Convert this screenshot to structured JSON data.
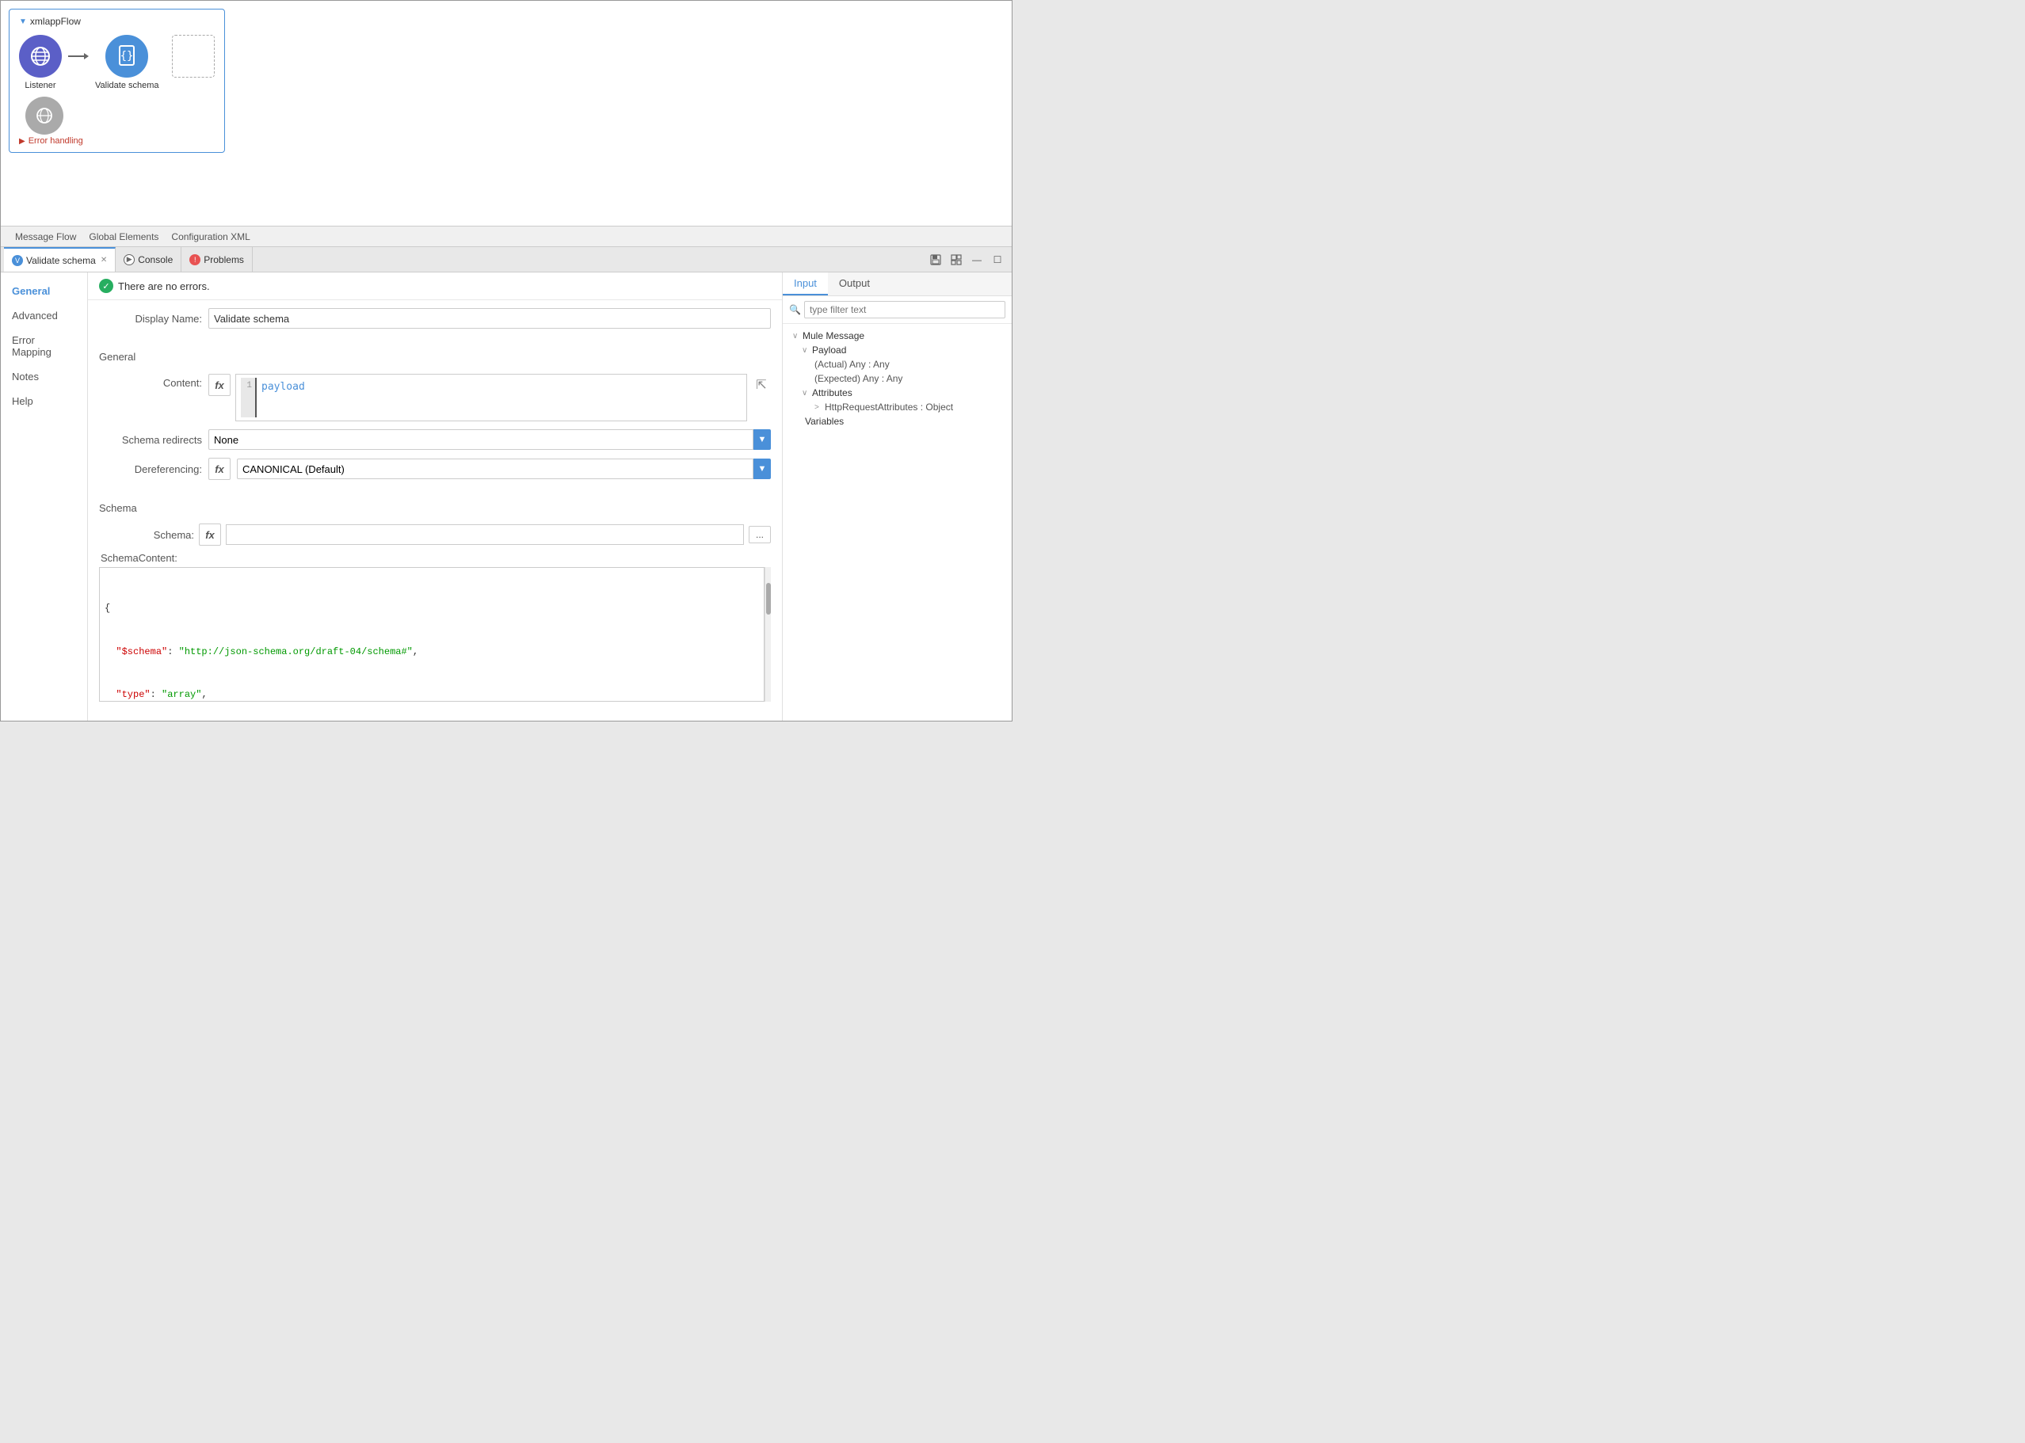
{
  "app": {
    "title": "xmlappFlow"
  },
  "canvas": {
    "flow_name": "xmlappFlow",
    "nodes": [
      {
        "id": "listener",
        "label": "Listener",
        "type": "globe",
        "style": "blue"
      },
      {
        "id": "validate_schema",
        "label": "Validate schema",
        "type": "document",
        "style": "blue-selected"
      }
    ],
    "bottom_node": {
      "label": "",
      "type": "globe",
      "style": "gray"
    },
    "error_section_label": "Error handling"
  },
  "bottom_tabs": [
    {
      "id": "message-flow",
      "label": "Message Flow"
    },
    {
      "id": "global-elements",
      "label": "Global Elements"
    },
    {
      "id": "configuration-xml",
      "label": "Configuration XML"
    }
  ],
  "panel_tabs": [
    {
      "id": "validate-schema",
      "label": "Validate schema",
      "active": true,
      "closeable": true
    },
    {
      "id": "console",
      "label": "Console",
      "active": false
    },
    {
      "id": "problems",
      "label": "Problems",
      "active": false
    }
  ],
  "panel_icons": [
    "save",
    "palette",
    "minimize",
    "maximize"
  ],
  "status": {
    "message": "There are no errors."
  },
  "form": {
    "display_name_label": "Display Name:",
    "display_name_value": "Validate schema",
    "general_section_label": "General",
    "content_label": "Content:",
    "content_code": "payload",
    "content_line_number": "1",
    "schema_redirects_label": "Schema redirects",
    "schema_redirects_value": "None",
    "dereferencing_label": "Dereferencing:",
    "dereferencing_value": "CANONICAL (Default)",
    "schema_section_label": "Schema",
    "schema_label": "Schema:",
    "schema_value": "",
    "schema_content_label": "SchemaContent:",
    "schema_content": "{\n  \"$schema\": \"http://json-schema.org/draft-04/schema#\",\n  \"type\": \"array\",\n  \"items\": {\n    \"type\": \"object\",\n    \"properties\": {\n      \"a\": {\n        \"type\": \"string\",\n        \"minLength\": 0,\n        \"maxLength\": 255\n      },\n      \"b\": {\n        \"type\": \"string\","
  },
  "sidebar_nav": [
    {
      "id": "general",
      "label": "General",
      "active": true
    },
    {
      "id": "advanced",
      "label": "Advanced",
      "active": false
    },
    {
      "id": "error-mapping",
      "label": "Error Mapping",
      "active": false
    },
    {
      "id": "notes",
      "label": "Notes",
      "active": false
    },
    {
      "id": "help",
      "label": "Help",
      "active": false
    }
  ],
  "right_panel": {
    "tabs": [
      {
        "id": "input",
        "label": "Input",
        "active": true
      },
      {
        "id": "output",
        "label": "Output",
        "active": false
      }
    ],
    "search_placeholder": "type filter text",
    "tree": {
      "mule_message": "Mule Message",
      "payload": "Payload",
      "actual": "(Actual) Any : Any",
      "expected": "(Expected) Any : Any",
      "attributes": "Attributes",
      "http_request_attrs": "HttpRequestAttributes : Object",
      "variables": "Variables"
    }
  }
}
